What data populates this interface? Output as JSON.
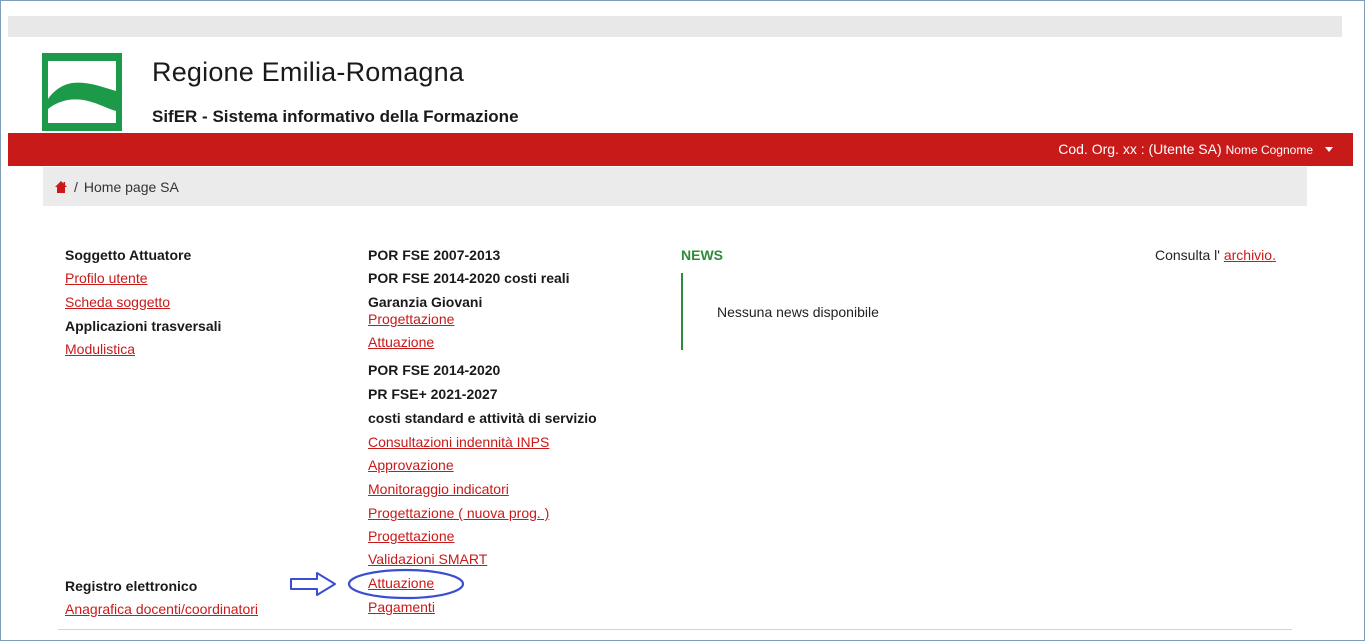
{
  "header": {
    "title": "Regione Emilia-Romagna",
    "subtitle": "SifER - Sistema informativo della Formazione",
    "user_org": "Cod. Org. xx : (Utente SA)",
    "user_name": "Nome Cognome"
  },
  "breadcrumb": {
    "separator": "/",
    "current": "Home page SA"
  },
  "left_col": {
    "section1_title": "Soggetto Attuatore",
    "profilo_utente": "Profilo utente",
    "scheda_soggetto": "Scheda soggetto",
    "section2_title": "Applicazioni trasversali",
    "modulistica": "Modulistica",
    "section3_title": "Registro elettronico",
    "anagrafica": "Anagrafica docenti/coordinatori"
  },
  "mid_col": {
    "por_2007": "POR FSE 2007-2013",
    "por_2014_reali": "POR FSE 2014-2020 costi reali",
    "garanzia": "Garanzia Giovani",
    "gg_progettazione": "Progettazione",
    "gg_attuazione": "Attuazione",
    "por_2014": "POR FSE 2014-2020",
    "pr_2021": "PR FSE+ 2021-2027",
    "costi_standard": "costi standard e attività di servizio",
    "consultazioni": "Consultazioni indennità INPS",
    "approvazione": "Approvazione",
    "monitoraggio": "Monitoraggio indicatori",
    "progettazione_nuova": "Progettazione ( nuova prog. )",
    "progettazione": "Progettazione",
    "validazioni": "Validazioni SMART",
    "attuazione": "Attuazione",
    "pagamenti": "Pagamenti"
  },
  "news": {
    "title": "NEWS",
    "empty": "Nessuna news disponibile",
    "archive_prefix": "Consulta l'",
    "archive_link": "archivio."
  },
  "colors": {
    "brand_red": "#c91a1a",
    "brand_green": "#2e8b3a",
    "annotation_blue": "#3a4fd0"
  }
}
